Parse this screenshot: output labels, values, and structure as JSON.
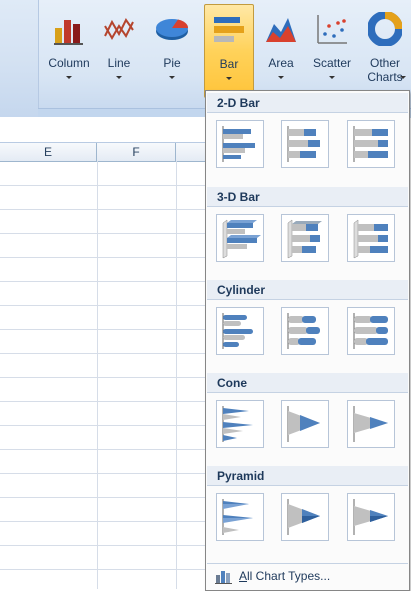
{
  "ribbon": {
    "buttons": [
      {
        "label": "Column"
      },
      {
        "label": "Line"
      },
      {
        "label": "Pie"
      },
      {
        "label": "Bar"
      },
      {
        "label": "Area"
      },
      {
        "label": "Scatter"
      },
      {
        "label": "Other",
        "label2": "Charts"
      }
    ]
  },
  "sheet": {
    "columns": [
      "E",
      "F"
    ]
  },
  "dropdown": {
    "sections": [
      {
        "title": "2-D Bar"
      },
      {
        "title": "3-D Bar"
      },
      {
        "title": "Cylinder"
      },
      {
        "title": "Cone"
      },
      {
        "title": "Pyramid"
      }
    ],
    "footer_label": "All Chart Types..."
  }
}
